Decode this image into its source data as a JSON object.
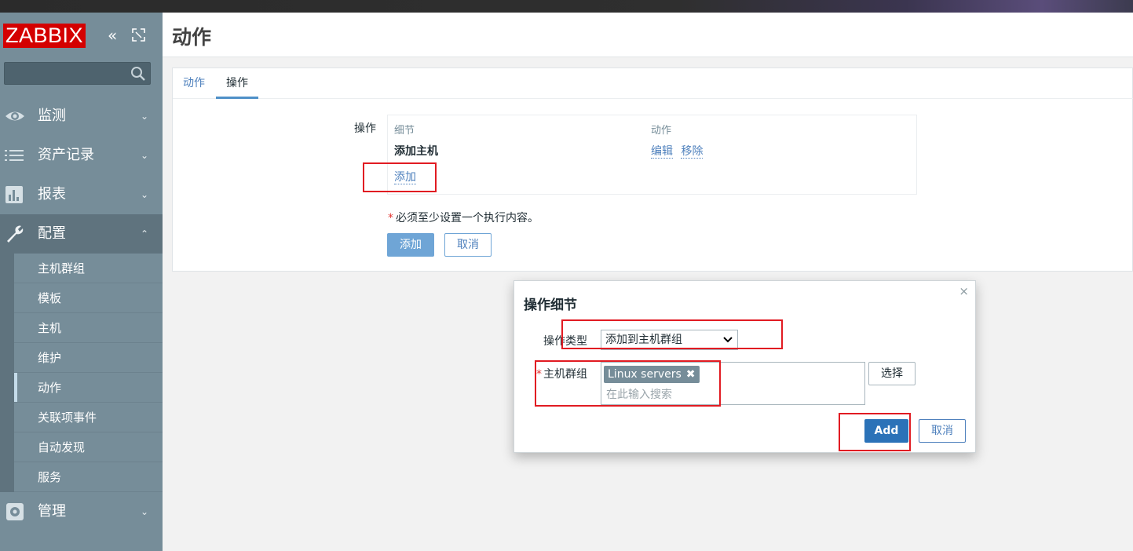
{
  "app": {
    "logo_text": "ZABBIX",
    "collapse_glyph": "«",
    "page_title": "动作",
    "colors": {
      "sidebar": "#768d99",
      "logo": "#d40000",
      "link": "#4f81bd",
      "primary": "#2b72b8",
      "annotation": "#e11b22"
    }
  },
  "sidebar": {
    "search": {
      "value": "",
      "icon": "search-icon"
    },
    "menu": [
      {
        "label": "监测",
        "icon": "eye-icon",
        "caret": "⌄"
      },
      {
        "label": "资产记录",
        "icon": "list-icon",
        "caret": "⌄"
      },
      {
        "label": "报表",
        "icon": "bar-chart-icon",
        "caret": "⌄"
      },
      {
        "label": "配置",
        "icon": "wrench-icon",
        "caret": "⌃"
      }
    ],
    "config_submenu": [
      "主机群组",
      "模板",
      "主机",
      "维护",
      "动作",
      "关联项事件",
      "自动发现",
      "服务"
    ],
    "admin": {
      "label": "管理",
      "icon": "gear-icon",
      "caret": "⌄"
    }
  },
  "tabs": [
    "动作",
    "操作"
  ],
  "operations": {
    "label": "操作",
    "col_detail": "细节",
    "col_action": "动作",
    "row_detail": "添加主机",
    "edit_link": "编辑",
    "remove_link": "移除",
    "add_link": "添加"
  },
  "form": {
    "required_note": "必须至少设置一个执行内容。",
    "required_star": "*",
    "submit_label": "添加",
    "cancel_label": "取消"
  },
  "modal": {
    "title": "操作细节",
    "close_glyph": "×",
    "op_type_label": "操作类型",
    "op_type_value": "添加到主机群组",
    "host_group_label": "主机群组",
    "chip_label": "Linux servers",
    "chip_remove": "✖",
    "search_placeholder": "在此输入搜索",
    "select_button": "选择",
    "add_button": "Add",
    "cancel_button": "取消"
  }
}
